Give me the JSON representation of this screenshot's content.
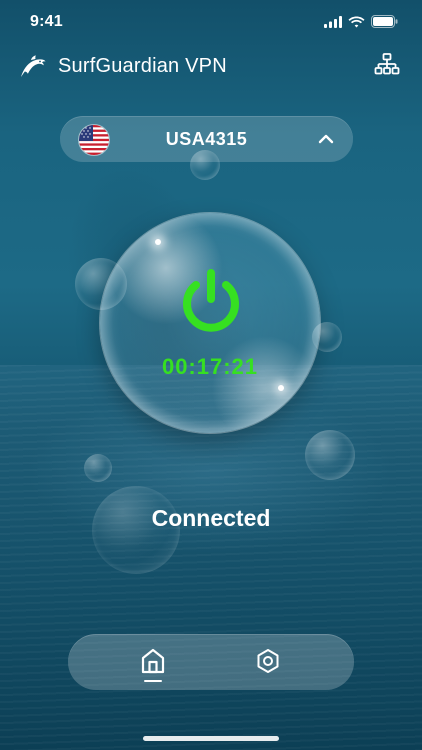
{
  "status_bar": {
    "time": "9:41",
    "icons": [
      "signal-icon",
      "wifi-icon",
      "battery-icon"
    ]
  },
  "header": {
    "title": "SurfGuardian VPN",
    "logo_icon": "dolphin-logo-icon",
    "action_icon": "network-icon"
  },
  "server": {
    "name": "USA4315",
    "flag_icon": "us-flag-icon",
    "chevron_icon": "chevron-up-icon"
  },
  "connection": {
    "timer": "00:17:21",
    "status": "Connected",
    "power_icon": "power-icon",
    "accent_color": "#36e021"
  },
  "nav": {
    "items": [
      {
        "icon": "home-icon",
        "active": true
      },
      {
        "icon": "settings-icon",
        "active": false
      }
    ]
  },
  "colors": {
    "background_top": "#12506a",
    "background_bottom": "#0c3f55",
    "text": "#ffffff"
  }
}
